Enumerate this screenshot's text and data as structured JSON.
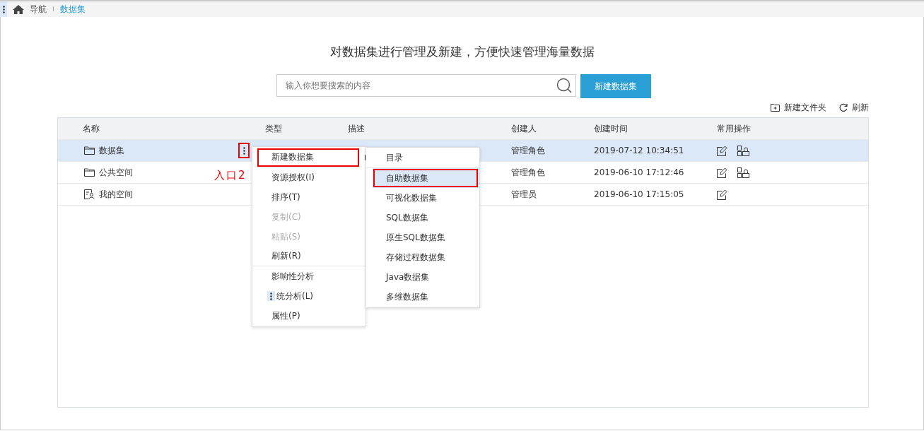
{
  "breadcrumb": {
    "items": [
      {
        "label": "导航",
        "selected": false
      },
      {
        "label": "数据集",
        "selected": true
      }
    ],
    "separator": "I"
  },
  "heading": "对数据集进行管理及新建，方便快速管理海量数据",
  "search": {
    "placeholder": "输入你想要搜索的内容"
  },
  "create_button": "新建数据集",
  "toolbar": [
    {
      "kind": "folder",
      "label": "新建文件夹"
    },
    {
      "kind": "refresh",
      "label": "刷新"
    }
  ],
  "table": {
    "columns": [
      "名称",
      "类型",
      "描述",
      "创建人",
      "创建时间",
      "常用操作"
    ],
    "rows": [
      {
        "kind": "folder",
        "name": "数据集",
        "selected": true,
        "menu_open": true,
        "creator": "管理角色",
        "time": "2019-07-12 10:34:51"
      },
      {
        "kind": "folder",
        "name": "公共空间",
        "selected": false,
        "menu_open": false,
        "creator": "管理角色",
        "time": "2019-06-10 17:12:46"
      },
      {
        "kind": "personal",
        "name": "我的空间",
        "selected": false,
        "menu_open": false,
        "creator": "管理员",
        "time": "2019-06-10 17:15:05"
      }
    ]
  },
  "annotation_label": "入口2",
  "context_menu": {
    "items": [
      {
        "kind": "submenu",
        "label": "新建数据集",
        "disabled": false,
        "annotated": true,
        "divider_after": true
      },
      {
        "kind": "action",
        "label": "资源授权(I)",
        "disabled": false,
        "annotated": false,
        "divider_after": false
      },
      {
        "kind": "action",
        "label": "排序(T)",
        "disabled": false,
        "annotated": false,
        "divider_after": false
      },
      {
        "kind": "action",
        "label": "复制(C)",
        "disabled": true,
        "annotated": false,
        "divider_after": false
      },
      {
        "kind": "action",
        "label": "粘贴(S)",
        "disabled": true,
        "annotated": false,
        "divider_after": false
      },
      {
        "kind": "action",
        "label": "刷新(R)",
        "disabled": false,
        "annotated": false,
        "divider_after": true
      },
      {
        "kind": "action",
        "label": "影响性分析",
        "disabled": false,
        "annotated": false,
        "divider_after": false
      },
      {
        "kind": "covered",
        "label": "统分析(L)",
        "disabled": false,
        "annotated": false,
        "divider_after": false
      },
      {
        "kind": "action",
        "label": "属性(P)",
        "disabled": false,
        "annotated": false,
        "divider_after": false
      }
    ]
  },
  "submenu": {
    "items": [
      {
        "label": "目录",
        "selected": false,
        "annotated": false,
        "divider_after": true
      },
      {
        "label": "自助数据集",
        "selected": true,
        "annotated": true,
        "divider_after": false
      },
      {
        "label": "可视化数据集",
        "selected": false,
        "annotated": false,
        "divider_after": false
      },
      {
        "label": "SQL数据集",
        "selected": false,
        "annotated": false,
        "divider_after": false
      },
      {
        "label": "原生SQL数据集",
        "selected": false,
        "annotated": false,
        "divider_after": false
      },
      {
        "label": "存储过程数据集",
        "selected": false,
        "annotated": false,
        "divider_after": false
      },
      {
        "label": "Java数据集",
        "selected": false,
        "annotated": false,
        "divider_after": false
      },
      {
        "label": "多维数据集",
        "selected": false,
        "annotated": false,
        "divider_after": false
      }
    ]
  }
}
